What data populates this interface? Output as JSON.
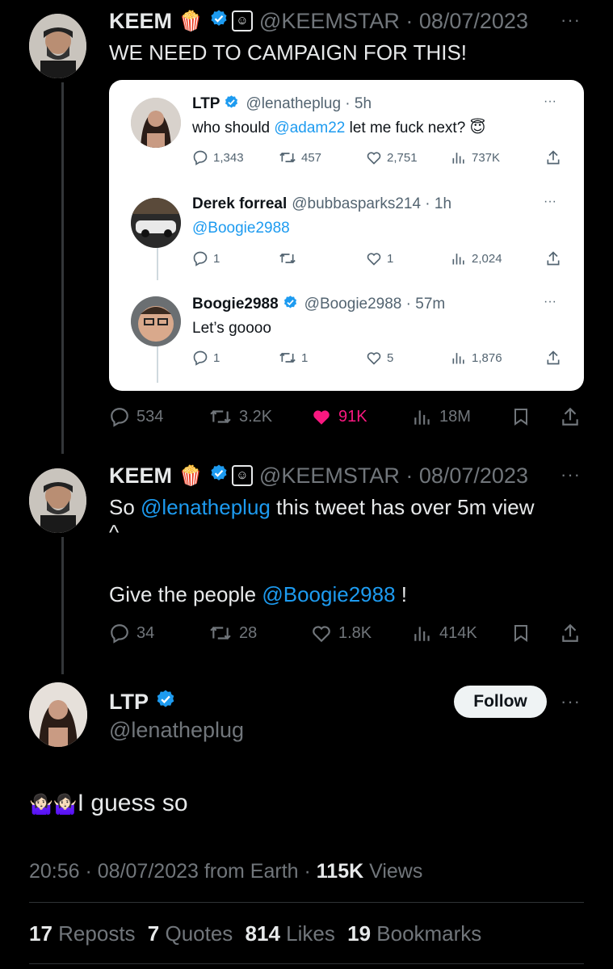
{
  "tweet1": {
    "name": "KEEM",
    "name_emoji": "🍿",
    "handle_date": "@KEEMSTAR · 08/07/2023",
    "text": "WE NEED TO CAMPAIGN FOR THIS!",
    "stats": {
      "replies": "534",
      "reposts": "3.2K",
      "likes": "91K",
      "views": "18M"
    }
  },
  "quote": {
    "t1": {
      "name": "LTP",
      "handle_time": "@lenatheplug · 5h",
      "text_before": "who should ",
      "mention": "@adam22",
      "text_after": " let me fuck next? 😇",
      "stats": {
        "replies": "1,343",
        "reposts": "457",
        "likes": "2,751",
        "views": "737K"
      }
    },
    "t2": {
      "name": "Derek forreal",
      "handle_time": "@bubbasparks214 · 1h",
      "mention": "@Boogie2988",
      "stats": {
        "replies": "1",
        "reposts": "",
        "likes": "1",
        "views": "2,024"
      }
    },
    "t3": {
      "name": "Boogie2988",
      "handle_time": "@Boogie2988 · 57m",
      "text": "Let’s goooo",
      "stats": {
        "replies": "1",
        "reposts": "1",
        "likes": "5",
        "views": "1,876"
      }
    }
  },
  "tweet2": {
    "name": "KEEM",
    "name_emoji": "🍿",
    "handle_date": "@KEEMSTAR · 08/07/2023",
    "line1_before": "So ",
    "line1_mention": "@lenatheplug",
    "line1_after": " this tweet has over 5m view",
    "line2": "^",
    "line3_before": "Give the people ",
    "line3_mention": "@Boogie2988",
    "line3_after": " !",
    "stats": {
      "replies": "34",
      "reposts": "28",
      "likes": "1.8K",
      "views": "414K"
    }
  },
  "main": {
    "name": "LTP",
    "handle": "@lenatheplug",
    "follow_label": "Follow",
    "text_emoji": "🤷🏻‍♀️🤷🏻‍♀️",
    "text": "I guess so",
    "meta_time": "20:56 · 08/07/2023 from Earth · ",
    "meta_views_count": "115K",
    "meta_views_label": " Views",
    "counts": {
      "reposts_n": "17",
      "reposts_label": "Reposts",
      "quotes_n": "7",
      "quotes_label": "Quotes",
      "likes_n": "814",
      "likes_label": "Likes",
      "bookmarks_n": "19",
      "bookmarks_label": "Bookmarks"
    }
  },
  "colors": {
    "link": "#1d9bf0",
    "like_active": "#f91880",
    "verified": "#1d9bf0"
  }
}
